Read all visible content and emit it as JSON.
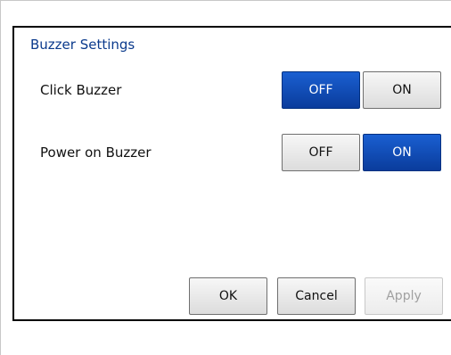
{
  "section": {
    "title": "Buzzer Settings"
  },
  "settings": [
    {
      "label": "Click Buzzer",
      "off_label": "OFF",
      "on_label": "ON",
      "selected": "OFF"
    },
    {
      "label": "Power on Buzzer",
      "off_label": "OFF",
      "on_label": "ON",
      "selected": "ON"
    }
  ],
  "footer": {
    "ok_label": "OK",
    "cancel_label": "Cancel",
    "apply_label": "Apply",
    "apply_enabled": false
  },
  "colors": {
    "selected": "#0a3c9c",
    "title": "#0b3a8c"
  }
}
